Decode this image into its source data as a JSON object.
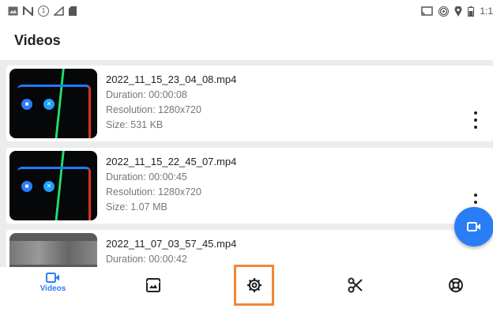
{
  "status_bar": {
    "left_icons": [
      "image-icon",
      "n-icon",
      "notification-count-icon",
      "signal-icon",
      "sd-card-icon"
    ],
    "right_icons": [
      "cast-icon",
      "hotspot-icon",
      "location-icon",
      "battery-icon"
    ],
    "notification_count": "1",
    "time": "1:1"
  },
  "page": {
    "title": "Videos"
  },
  "videos": [
    {
      "file_name": "2022_11_15_23_04_08.mp4",
      "duration": "Duration: 00:00:08",
      "resolution": "Resolution: 1280x720",
      "size": "Size: 531 KB"
    },
    {
      "file_name": "2022_11_15_22_45_07.mp4",
      "duration": "Duration: 00:00:45",
      "resolution": "Resolution: 1280x720",
      "size": "Size: 1.07 MB"
    },
    {
      "file_name": "2022_11_07_03_57_45.mp4",
      "duration": "Duration: 00:00:42"
    }
  ],
  "fab": {
    "icon": "video-camera-icon"
  },
  "bottom_nav": {
    "items": [
      {
        "label": "Videos",
        "icon": "video-camera-icon",
        "active": true
      },
      {
        "label": "",
        "icon": "gallery-icon"
      },
      {
        "label": "",
        "icon": "settings-icon",
        "highlighted": true
      },
      {
        "label": "",
        "icon": "scissors-icon"
      },
      {
        "label": "",
        "icon": "support-icon"
      }
    ]
  },
  "colors": {
    "accent": "#2a7ef5",
    "highlight": "#f0883a",
    "list_bg": "#ececec"
  }
}
